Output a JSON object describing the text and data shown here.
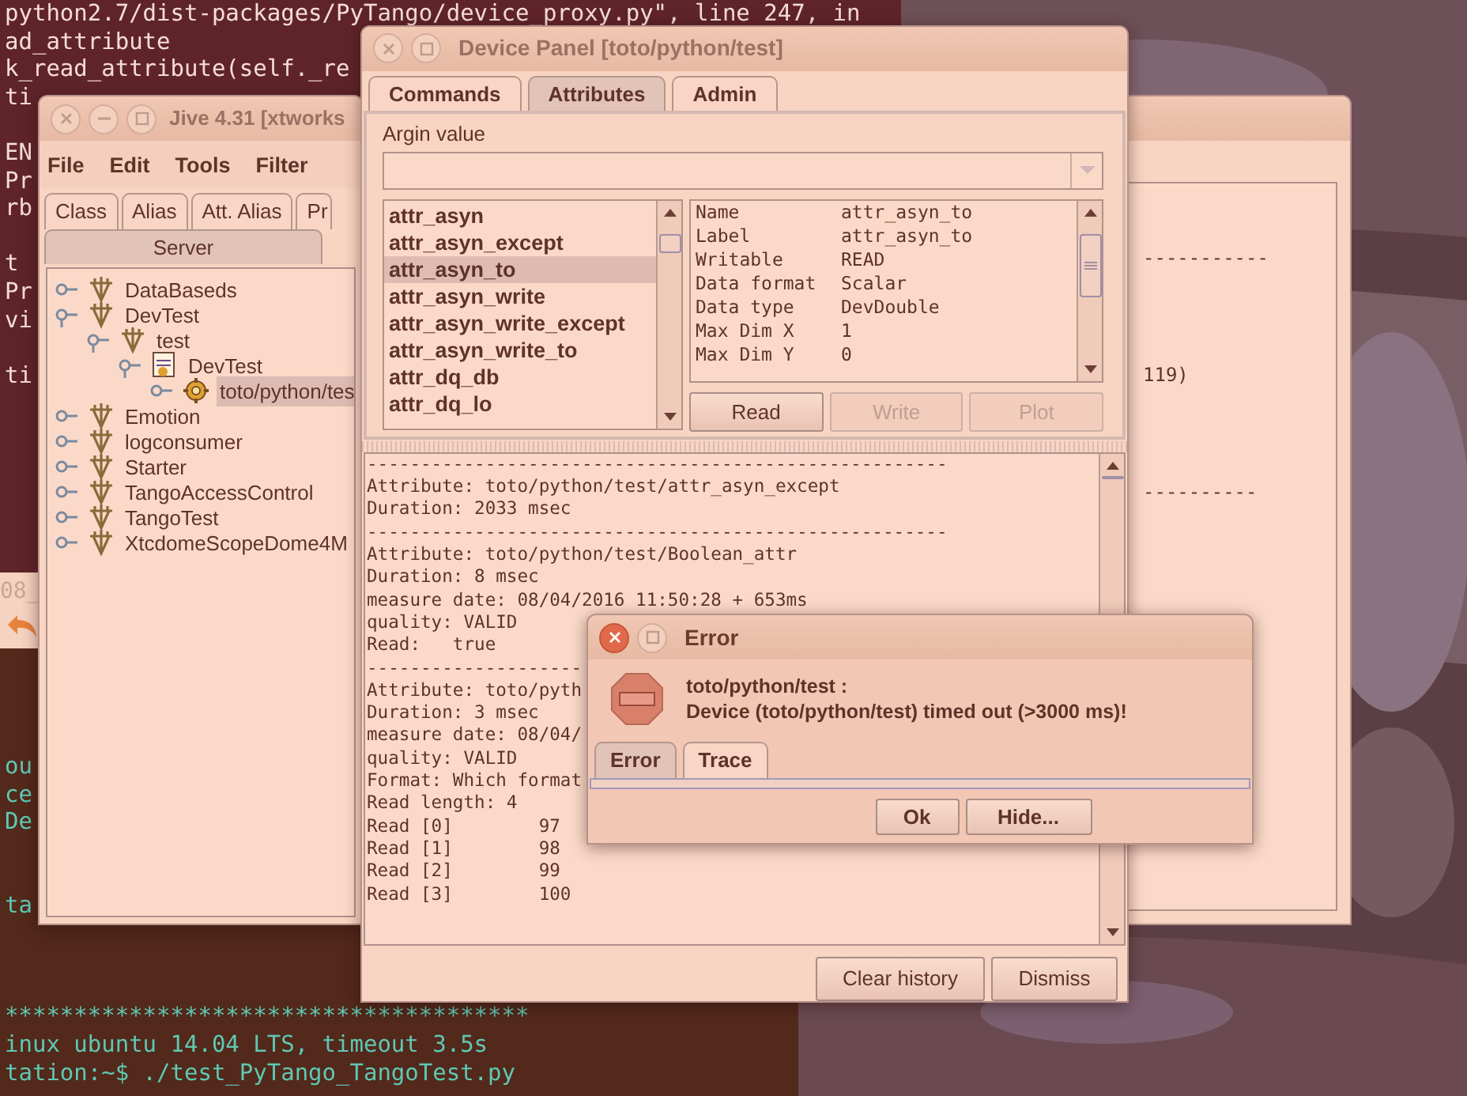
{
  "terminal_top": {
    "blocks": [
      [
        "python2.7/dist-packages/PyTango/device_proxy.py\", line 247, in",
        "ad_attribute",
        "k_read_attribute(self._re",
        "ti"
      ],
      [
        "EN",
        "Pr",
        "rb"
      ],
      [
        "t",
        "Pr",
        "vi"
      ],
      [
        "ti"
      ]
    ]
  },
  "back_window": {
    "text": "08_"
  },
  "terminal_bottom": {
    "blocks": [
      [
        "ou",
        "ce",
        "De"
      ],
      [
        "ta"
      ],
      [
        "**************************************",
        "inux ubuntu 14.04 LTS, timeout 3.5s"
      ],
      [
        "tation:~$ ./test_PyTango_TangoTest.py"
      ]
    ]
  },
  "jive_window": {
    "title": "Jive 4.31  [xtworks",
    "menu": [
      "File",
      "Edit",
      "Tools",
      "Filter"
    ],
    "tabs": [
      {
        "label": "Class",
        "selected": false
      },
      {
        "label": "Alias",
        "selected": false
      },
      {
        "label": "Att. Alias",
        "selected": false
      },
      {
        "label": "Pr",
        "selected": false
      }
    ],
    "tabs_row2": [
      {
        "label": "Server",
        "selected": true
      }
    ],
    "tree": [
      {
        "label": "DataBaseds",
        "kind": "server",
        "expanded": false,
        "selected": false
      },
      {
        "label": "DevTest",
        "kind": "server",
        "expanded": true,
        "selected": false,
        "children": [
          {
            "label": "test",
            "kind": "server",
            "expanded": true,
            "selected": false,
            "children": [
              {
                "label": "DevTest",
                "kind": "class",
                "expanded": true,
                "selected": false,
                "children": [
                  {
                    "label": "toto/python/tes",
                    "kind": "device",
                    "expanded": false,
                    "selected": true
                  }
                ]
              }
            ]
          }
        ]
      },
      {
        "label": "Emotion",
        "kind": "server",
        "expanded": false,
        "selected": false
      },
      {
        "label": "logconsumer",
        "kind": "server",
        "expanded": false,
        "selected": false
      },
      {
        "label": "Starter",
        "kind": "server",
        "expanded": false,
        "selected": false
      },
      {
        "label": "TangoAccessControl",
        "kind": "server",
        "expanded": false,
        "selected": false
      },
      {
        "label": "TangoTest",
        "kind": "server",
        "expanded": false,
        "selected": false
      },
      {
        "label": "XtcdomeScopeDome4M",
        "kind": "server",
        "expanded": false,
        "selected": false
      }
    ]
  },
  "right_window": {
    "lines": [
      "-----------",
      "119)",
      "----------"
    ]
  },
  "device_panel": {
    "title": "Device Panel [toto/python/test]",
    "tabs": [
      {
        "label": "Commands",
        "selected": false
      },
      {
        "label": "Attributes",
        "selected": true
      },
      {
        "label": "Admin",
        "selected": false
      }
    ],
    "argin_label": "Argin value",
    "attributes": [
      {
        "name": "attr_asyn",
        "selected": false
      },
      {
        "name": "attr_asyn_except",
        "selected": false
      },
      {
        "name": "attr_asyn_to",
        "selected": true
      },
      {
        "name": "attr_asyn_write",
        "selected": false
      },
      {
        "name": "attr_asyn_write_except",
        "selected": false
      },
      {
        "name": "attr_asyn_write_to",
        "selected": false
      },
      {
        "name": "attr_dq_db",
        "selected": false
      },
      {
        "name": "attr_dq_lo",
        "selected": false
      }
    ],
    "properties": [
      {
        "key": "Name",
        "value": "attr_asyn_to"
      },
      {
        "key": "Label",
        "value": "attr_asyn_to"
      },
      {
        "key": "Writable",
        "value": "READ"
      },
      {
        "key": "Data format",
        "value": "Scalar"
      },
      {
        "key": "Data type",
        "value": "DevDouble"
      },
      {
        "key": "Max Dim X",
        "value": "1"
      },
      {
        "key": "Max Dim Y",
        "value": "0"
      }
    ],
    "actions": [
      {
        "label": "Read",
        "disabled": false
      },
      {
        "label": "Write",
        "disabled": true
      },
      {
        "label": "Plot",
        "disabled": true
      }
    ],
    "log": [
      "------------------------------------------------------",
      "Attribute: toto/python/test/attr_asyn_except",
      "Duration: 2033 msec",
      "------------------------------------------------------",
      "Attribute: toto/python/test/Boolean_attr",
      "Duration: 8 msec",
      "measure date: 08/04/2016 11:50:28 + 653ms",
      "quality: VALID",
      "Read:   true",
      "--------------------",
      "Attribute: toto/pyth",
      "Duration: 3 msec",
      "measure date: 08/04/",
      "quality: VALID",
      "Format: Which format",
      "Read length: 4",
      "Read [0]        97",
      "Read [1]        98",
      "Read [2]        99",
      "Read [3]        100"
    ],
    "buttons": [
      "Clear history",
      "Dismiss"
    ]
  },
  "error_dialog": {
    "title": "Error",
    "message": [
      "toto/python/test :",
      "Device (toto/python/test) timed out (>3000 ms)!"
    ],
    "tabs": [
      {
        "label": "Error",
        "selected": true
      },
      {
        "label": "Trace",
        "selected": false
      }
    ],
    "buttons": [
      "Ok",
      "Hide..."
    ]
  }
}
